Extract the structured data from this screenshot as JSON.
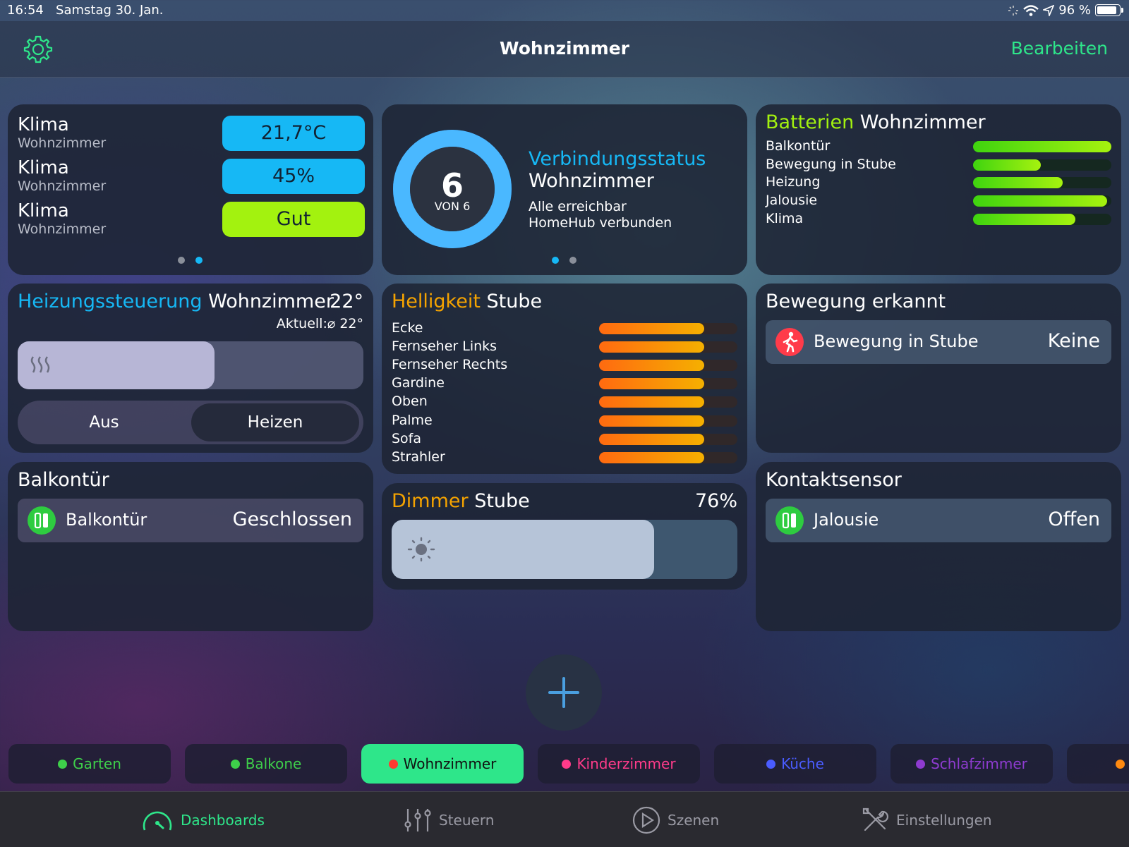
{
  "status": {
    "time": "16:54",
    "date": "Samstag 30. Jan.",
    "battery": "96 %"
  },
  "nav": {
    "title": "Wohnzimmer",
    "edit_label": "Bearbeiten"
  },
  "klima": {
    "rows": [
      {
        "title": "Klima",
        "sub": "Wohnzimmer",
        "value": "21,7°C",
        "color": "#16b8f5"
      },
      {
        "title": "Klima",
        "sub": "Wohnzimmer",
        "value": "45%",
        "color": "#16b8f5"
      },
      {
        "title": "Klima",
        "sub": "Wohnzimmer",
        "value": "Gut",
        "color": "#a3f20f"
      }
    ]
  },
  "verbindung": {
    "count": "6",
    "von": "VON 6",
    "title_accent": "Verbindungsstatus",
    "title_rest": "Wohnzimmer",
    "line1": "Alle erreichbar",
    "line2": "HomeHub verbunden",
    "progress": 1.0
  },
  "batterien": {
    "title_accent": "Batterien",
    "title_rest": "Wohnzimmer",
    "items": [
      {
        "label": "Balkontür",
        "level": 1.0
      },
      {
        "label": "Bewegung in Stube",
        "level": 0.49
      },
      {
        "label": "Heizung",
        "level": 0.65
      },
      {
        "label": "Jalousie",
        "level": 0.97
      },
      {
        "label": "Klima",
        "level": 0.74
      }
    ]
  },
  "heizung": {
    "title_accent": "Heizungssteuerung",
    "title_rest": "Wohnzimmer",
    "target": "22°",
    "current": "Aktuell:⌀ 22°",
    "level": 0.57,
    "off_label": "Aus",
    "heat_label": "Heizen"
  },
  "helligkeit": {
    "title_accent": "Helligkeit",
    "title_rest": "Stube",
    "items": [
      {
        "label": "Ecke",
        "level": 0.76
      },
      {
        "label": "Fernseher Links",
        "level": 0.76
      },
      {
        "label": "Fernseher Rechts",
        "level": 0.76
      },
      {
        "label": "Gardine",
        "level": 0.76
      },
      {
        "label": "Oben",
        "level": 0.76
      },
      {
        "label": "Palme",
        "level": 0.76
      },
      {
        "label": "Sofa",
        "level": 0.76
      },
      {
        "label": "Strahler",
        "level": 0.76
      }
    ]
  },
  "bewegung": {
    "title": "Bewegung erkannt",
    "item": "Bewegung in Stube",
    "value": "Keine"
  },
  "balkontuer": {
    "title": "Balkontür",
    "item": "Balkontür",
    "value": "Geschlossen"
  },
  "dimmer": {
    "title_accent": "Dimmer",
    "title_rest": "Stube",
    "percent": "76%",
    "level": 0.76
  },
  "kontakt": {
    "title": "Kontaktsensor",
    "item": "Jalousie",
    "value": "Offen"
  },
  "rooms": [
    {
      "label": "Garten",
      "dot": "#3ecf4a",
      "active": false
    },
    {
      "label": "Balkone",
      "dot": "#3ecf4a",
      "active": false
    },
    {
      "label": "Wohnzimmer",
      "dot": "#ff3b30",
      "active": true
    },
    {
      "label": "Kinderzimmer",
      "dot": "#ff3b8a",
      "active": false
    },
    {
      "label": "Küche",
      "dot": "#4a5cff",
      "active": false
    },
    {
      "label": "Schlafzimmer",
      "dot": "#8e3bd0",
      "active": false
    }
  ],
  "bottom": {
    "dashboards": "Dashboards",
    "steuern": "Steuern",
    "szenen": "Szenen",
    "einstellungen": "Einstellungen"
  },
  "colors": {
    "accent_green": "#2ee68a",
    "blue": "#16b8f5",
    "lime": "#a3f20f",
    "orange": "#f5a300"
  }
}
